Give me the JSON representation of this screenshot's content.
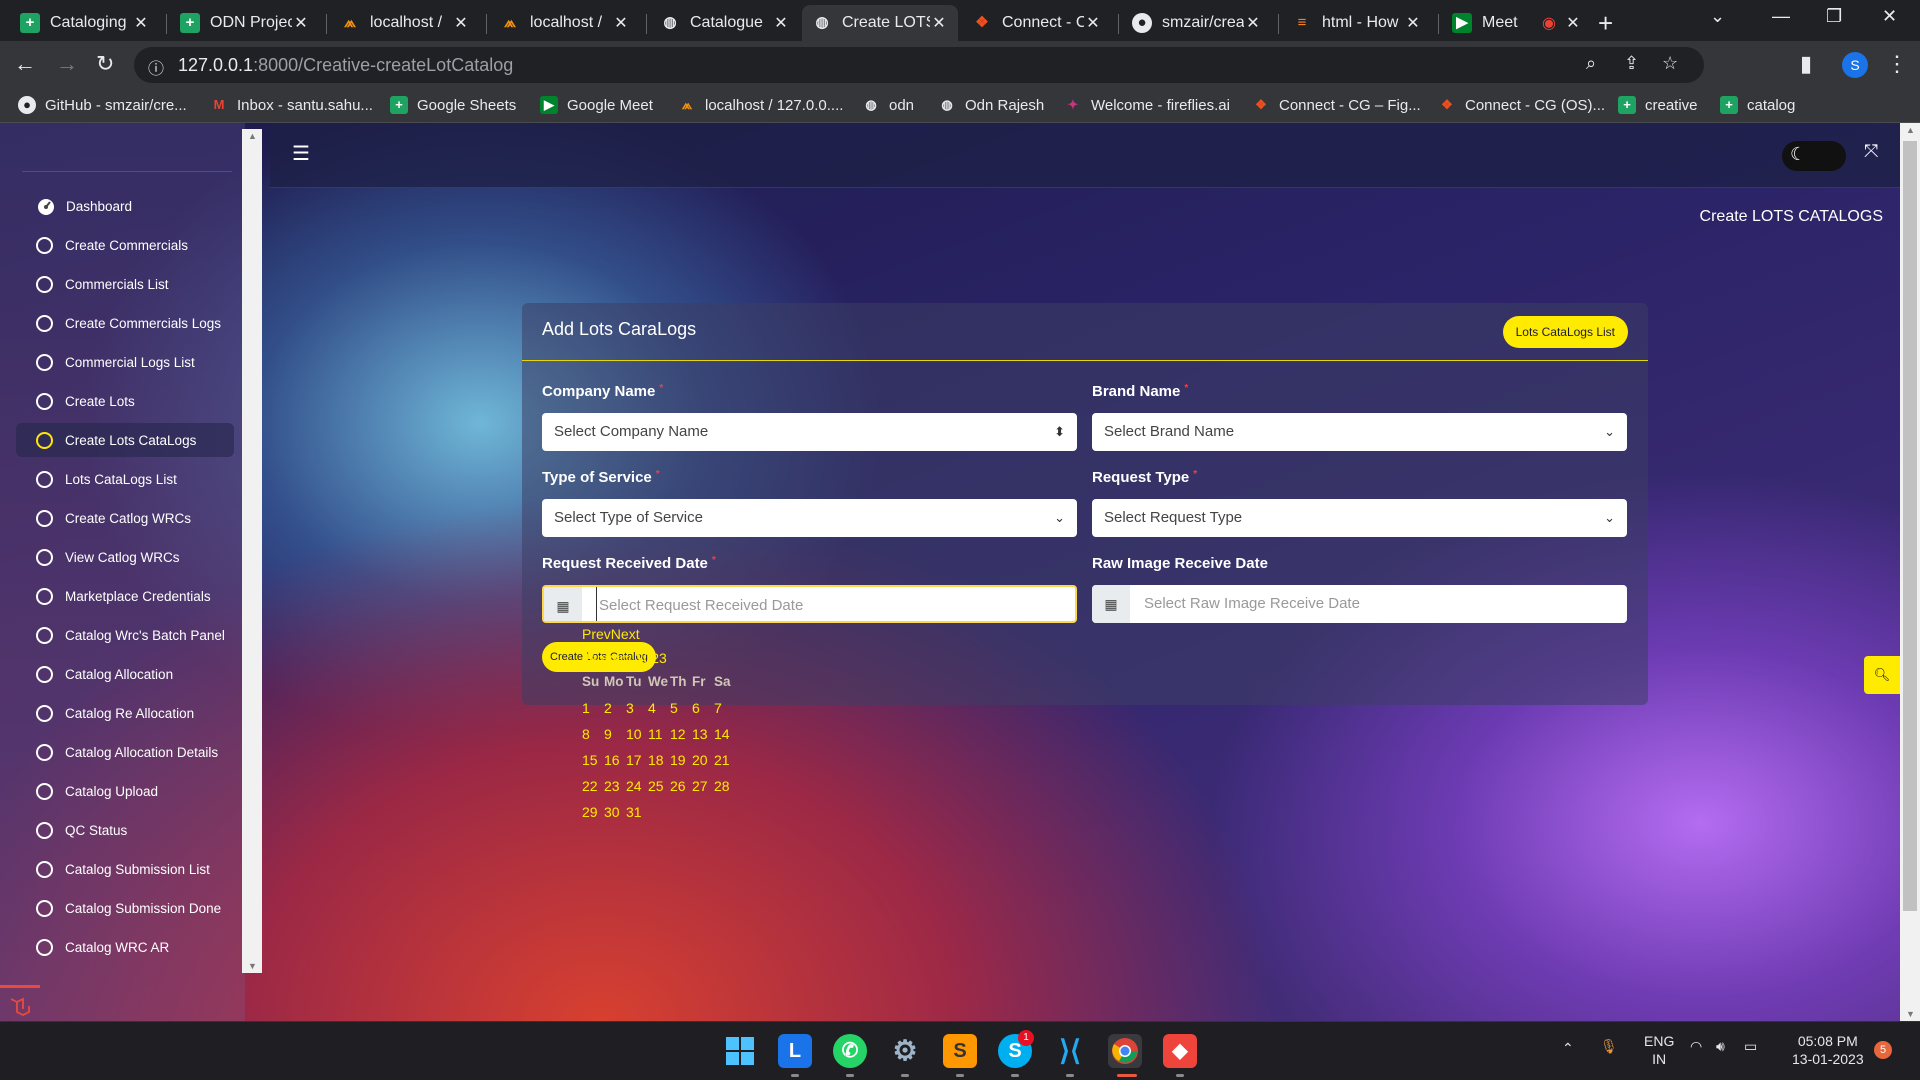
{
  "browser": {
    "tabs": [
      {
        "title": "Cataloging",
        "icon": "sheets-icon",
        "active": false
      },
      {
        "title": "ODN Project",
        "icon": "sheets-icon",
        "active": false
      },
      {
        "title": "localhost /",
        "icon": "phpmyadmin-icon",
        "active": false
      },
      {
        "title": "localhost /",
        "icon": "phpmyadmin-icon",
        "active": false
      },
      {
        "title": "Catalogue",
        "icon": "globe-icon",
        "active": false
      },
      {
        "title": "Create LOTS",
        "icon": "globe-icon",
        "active": true
      },
      {
        "title": "Connect - C",
        "icon": "figma-icon",
        "active": false
      },
      {
        "title": "smzair/crea",
        "icon": "github-icon",
        "active": false
      },
      {
        "title": "html - How",
        "icon": "stackoverflow-icon",
        "active": false
      },
      {
        "title": "Meet",
        "icon": "meet-icon",
        "active": false
      }
    ],
    "url_host": "127.0.0.1",
    "url_path": ":8000/Creative-createLotCatalog",
    "profile_initial": "S",
    "bookmarks": [
      {
        "label": "GitHub - smzair/cre...",
        "icon": "github-icon"
      },
      {
        "label": "Inbox - santu.sahu...",
        "icon": "gmail-icon"
      },
      {
        "label": "Google Sheets",
        "icon": "sheets-icon"
      },
      {
        "label": "Google Meet",
        "icon": "meet-icon"
      },
      {
        "label": "localhost / 127.0.0....",
        "icon": "phpmyadmin-icon"
      },
      {
        "label": "odn",
        "icon": "globe-icon"
      },
      {
        "label": "Odn Rajesh",
        "icon": "globe-icon"
      },
      {
        "label": "Welcome - fireflies.ai",
        "icon": "fireflies-icon"
      },
      {
        "label": "Connect - CG – Fig...",
        "icon": "figma-icon"
      },
      {
        "label": "Connect - CG (OS)...",
        "icon": "figma-icon"
      },
      {
        "label": "creative",
        "icon": "sheets-icon"
      },
      {
        "label": "catalog",
        "icon": "sheets-icon"
      }
    ]
  },
  "sidebar": {
    "items": [
      {
        "label": "Dashboard",
        "active": false
      },
      {
        "label": "Create Commercials",
        "active": false
      },
      {
        "label": "Commercials List",
        "active": false
      },
      {
        "label": "Create Commercials Logs",
        "active": false
      },
      {
        "label": "Commercial Logs List",
        "active": false
      },
      {
        "label": "Create Lots",
        "active": false
      },
      {
        "label": "Create Lots CataLogs",
        "active": true
      },
      {
        "label": "Lots CataLogs List",
        "active": false
      },
      {
        "label": "Create Catlog WRCs",
        "active": false
      },
      {
        "label": "View Catlog WRCs",
        "active": false
      },
      {
        "label": "Marketplace Credentials",
        "active": false
      },
      {
        "label": "Catalog Wrc's Batch Panel",
        "active": false
      },
      {
        "label": "Catalog Allocation",
        "active": false
      },
      {
        "label": "Catalog Re Allocation",
        "active": false
      },
      {
        "label": "Catalog Allocation Details",
        "active": false
      },
      {
        "label": "Catalog Upload",
        "active": false
      },
      {
        "label": "QC Status",
        "active": false
      },
      {
        "label": "Catalog Submission List",
        "active": false
      },
      {
        "label": "Catalog Submission Done",
        "active": false
      },
      {
        "label": "Catalog WRC AR",
        "active": false
      }
    ]
  },
  "page": {
    "title": "Create LOTS CATALOGS",
    "card_title": "Add Lots CaraLogs",
    "list_button": "Lots CataLogs List",
    "submit_button": "Create Lots Catalog",
    "fields": {
      "company": {
        "label": "Company Name",
        "required": "*",
        "placeholder": "Select Company Name"
      },
      "brand": {
        "label": "Brand Name",
        "required": "*",
        "placeholder": "Select Brand Name"
      },
      "service": {
        "label": "Type of Service",
        "required": "*",
        "placeholder": "Select Type of Service"
      },
      "request": {
        "label": "Request Type",
        "required": "*",
        "placeholder": "Select Request Type"
      },
      "received": {
        "label": "Request Received Date",
        "required": "*",
        "placeholder": "Select Request Received Date"
      },
      "raw": {
        "label": "Raw Image Receive Date",
        "placeholder": "Select Raw Image Receive Date"
      }
    }
  },
  "datepicker": {
    "prev": "Prev",
    "next": "Next",
    "month": "January 2023",
    "weekdays": [
      "Su",
      "Mo",
      "Tu",
      "We",
      "Th",
      "Fr",
      "Sa"
    ],
    "weeks": [
      [
        "1",
        "2",
        "3",
        "4",
        "5",
        "6",
        "7"
      ],
      [
        "8",
        "9",
        "10",
        "11",
        "12",
        "13",
        "14"
      ],
      [
        "15",
        "16",
        "17",
        "18",
        "19",
        "20",
        "21"
      ],
      [
        "22",
        "23",
        "24",
        "25",
        "26",
        "27",
        "28"
      ],
      [
        "29",
        "30",
        "31",
        "",
        "",
        "",
        ""
      ]
    ]
  },
  "taskbar": {
    "lang": "ENG",
    "region": "IN",
    "time": "05:08 PM",
    "date": "13-01-2023",
    "notif_count": "5",
    "skype_badge": "1",
    "apps": [
      "windows-start-icon",
      "lens-icon",
      "whatsapp-icon",
      "settings-icon",
      "sublime-icon",
      "skype-icon",
      "vscode-icon",
      "chrome-icon",
      "anydesk-icon"
    ]
  }
}
